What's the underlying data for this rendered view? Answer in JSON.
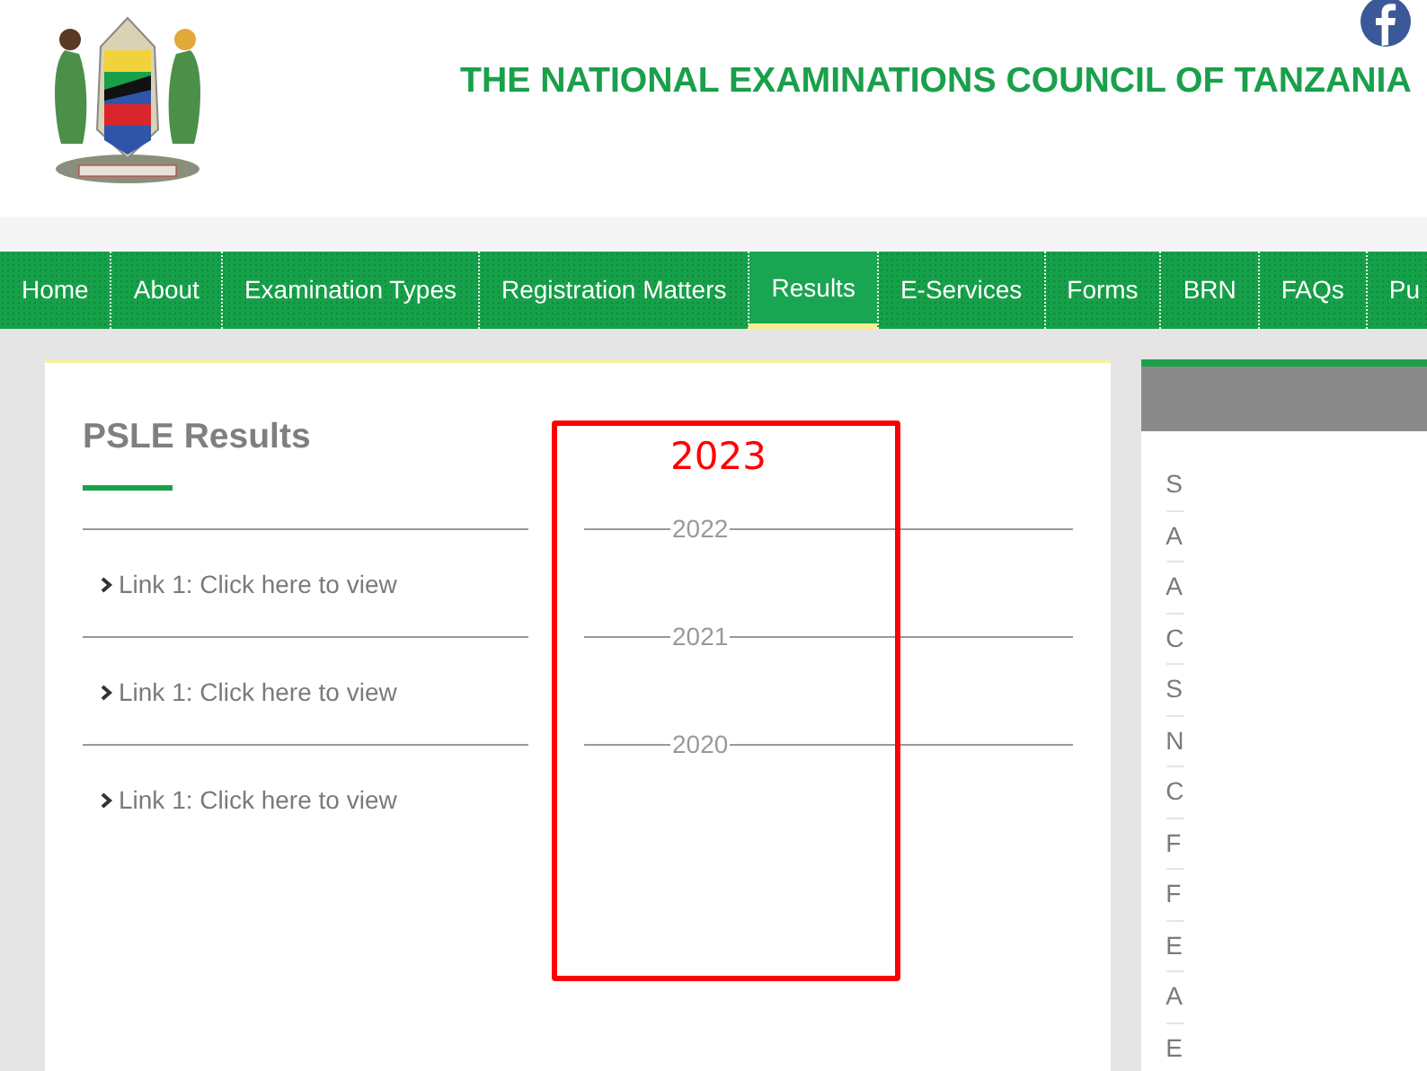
{
  "header": {
    "title": "THE NATIONAL EXAMINATIONS COUNCIL OF TANZANIA"
  },
  "nav": [
    {
      "label": "Home",
      "selected": false
    },
    {
      "label": "About",
      "selected": false
    },
    {
      "label": "Examination Types",
      "selected": false
    },
    {
      "label": "Registration Matters",
      "selected": false
    },
    {
      "label": "Results",
      "selected": true
    },
    {
      "label": "E-Services",
      "selected": false
    },
    {
      "label": "Forms",
      "selected": false
    },
    {
      "label": "BRN",
      "selected": false
    },
    {
      "label": "FAQs",
      "selected": false
    },
    {
      "label": "Pu",
      "selected": false
    }
  ],
  "main": {
    "title": "PSLE Results",
    "rows": [
      {
        "link": "Link 1: Click here to view",
        "year": "2022"
      },
      {
        "link": "Link 1: Click here to view",
        "year": "2021"
      },
      {
        "link": "Link 1: Click here to view",
        "year": "2020"
      }
    ],
    "annotation": {
      "text": "2023"
    }
  },
  "sidebar": {
    "items": [
      "S",
      "A",
      "A",
      "C",
      "S",
      "N",
      "C",
      "F",
      "F",
      "E",
      "A",
      "E"
    ]
  }
}
